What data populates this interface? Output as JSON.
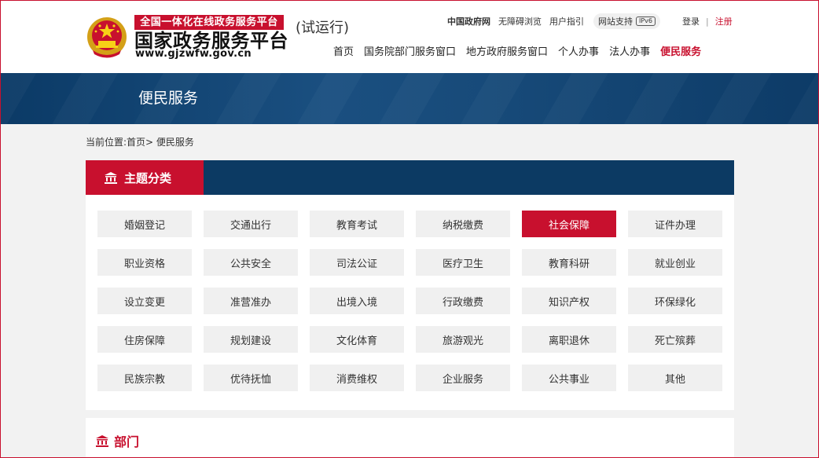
{
  "brand": {
    "banner": "全国一体化在线政务服务平台",
    "title": "国家政务服务平台",
    "url": "www.gjzwfw.gov.cn",
    "trial": "(试运行)",
    "colors": {
      "red": "#c8102e",
      "navy": "#0c3a63"
    }
  },
  "utility": {
    "gov": "中国政府网",
    "accessible": "无障碍浏览",
    "guide": "用户指引",
    "support": "网站支持",
    "ipv6": "IPv6"
  },
  "auth": {
    "login": "登录",
    "register": "注册"
  },
  "nav": {
    "items": [
      "首页",
      "国务院部门服务窗口",
      "地方政府服务窗口",
      "个人办事",
      "法人办事"
    ],
    "active": "便民服务"
  },
  "hero": {
    "title": "便民服务"
  },
  "breadcrumb": {
    "label": "当前位置:",
    "home": "首页>",
    "current": " 便民服务"
  },
  "topics": {
    "heading": "主题分类",
    "icon": "building-icon",
    "items": [
      "婚姻登记",
      "交通出行",
      "教育考试",
      "纳税缴费",
      "社会保障",
      "证件办理",
      "职业资格",
      "公共安全",
      "司法公证",
      "医疗卫生",
      "教育科研",
      "就业创业",
      "设立变更",
      "准营准办",
      "出境入境",
      "行政缴费",
      "知识产权",
      "环保绿化",
      "住房保障",
      "规划建设",
      "文化体育",
      "旅游观光",
      "离职退休",
      "死亡殡葬",
      "民族宗教",
      "优待抚恤",
      "消费维权",
      "企业服务",
      "公共事业",
      "其他"
    ],
    "active_index": 4
  },
  "dept": {
    "heading": "部门",
    "icon": "building-icon"
  }
}
